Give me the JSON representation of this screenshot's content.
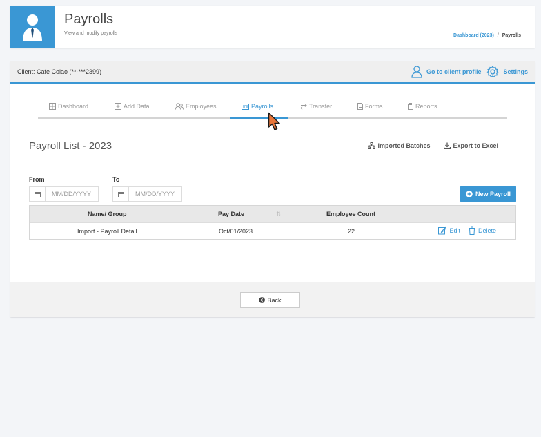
{
  "header": {
    "title": "Payrolls",
    "subtitle": "View and modify payrolls",
    "breadcrumb": {
      "link": "Dashboard (2023)",
      "separator": "/",
      "current": "Payrolls"
    },
    "icon": "user-tie-icon"
  },
  "client_bar": {
    "client": "Client: Cafe Colao (**-***2399)",
    "profile_link": "Go to client profile",
    "settings_link": "Settings"
  },
  "tabs": [
    {
      "label": "Dashboard",
      "icon": "grid-icon"
    },
    {
      "label": "Add Data",
      "icon": "plus-square-icon"
    },
    {
      "label": "Employees",
      "icon": "users-icon"
    },
    {
      "label": "Payrolls",
      "icon": "payroll-card-icon",
      "active": true
    },
    {
      "label": "Transfer",
      "icon": "exchange-icon"
    },
    {
      "label": "Forms",
      "icon": "document-icon"
    },
    {
      "label": "Reports",
      "icon": "clipboard-icon"
    }
  ],
  "list": {
    "title": "Payroll List - 2023",
    "imported_batches": "Imported Batches",
    "export_excel": "Export to Excel"
  },
  "filters": {
    "from_label": "From",
    "to_label": "To",
    "from_placeholder": "MM/DD/YYYY",
    "to_placeholder": "MM/DD/YYYY"
  },
  "new_payroll_label": "New Payroll",
  "table": {
    "columns": [
      "Name/ Group",
      "Pay Date",
      "Employee Count"
    ],
    "rows": [
      {
        "name": "Import - Payroll Detail",
        "pay_date": "Oct/01/2023",
        "employee_count": "22",
        "edit": "Edit",
        "delete": "Delete"
      }
    ]
  },
  "back_label": "Back",
  "colors": {
    "accent": "#3a97d4"
  }
}
